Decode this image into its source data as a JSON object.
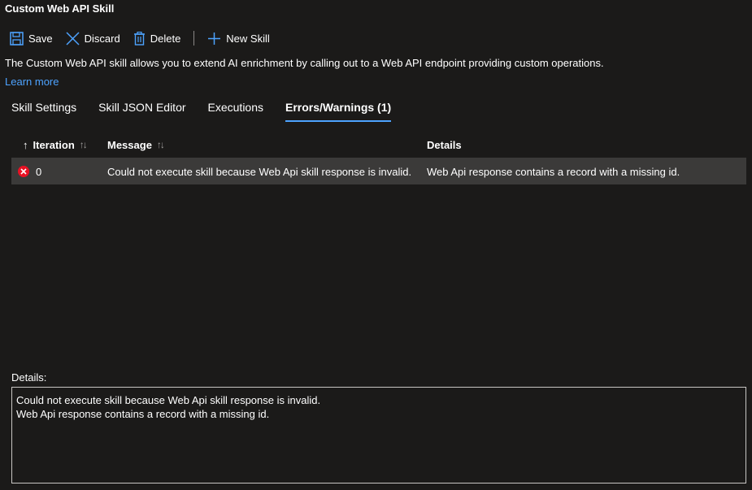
{
  "window": {
    "title": "Custom Web API Skill"
  },
  "toolbar": {
    "save_label": "Save",
    "discard_label": "Discard",
    "delete_label": "Delete",
    "new_skill_label": "New Skill"
  },
  "description": {
    "text": "The Custom Web API skill allows you to extend AI enrichment by calling out to a Web API endpoint providing custom operations.",
    "learn_more": "Learn more"
  },
  "tabs": [
    {
      "label": "Skill Settings",
      "active": false
    },
    {
      "label": "Skill JSON Editor",
      "active": false
    },
    {
      "label": "Executions",
      "active": false
    },
    {
      "label": "Errors/Warnings (1)",
      "active": true
    }
  ],
  "table": {
    "headers": {
      "iteration": "Iteration",
      "message": "Message",
      "details": "Details"
    },
    "rows": [
      {
        "iteration": "0",
        "message": "Could not execute skill because Web Api skill response is invalid.",
        "details": "Web Api response contains a record with a missing id."
      }
    ]
  },
  "details_panel": {
    "label": "Details:",
    "line1": "Could not execute skill because Web Api skill response is invalid.",
    "line2": "Web Api response contains a record with a missing id."
  },
  "colors": {
    "background": "#1b1a19",
    "accent": "#4da3ff",
    "selected_row": "#3b3a39",
    "error": "#e81123"
  }
}
